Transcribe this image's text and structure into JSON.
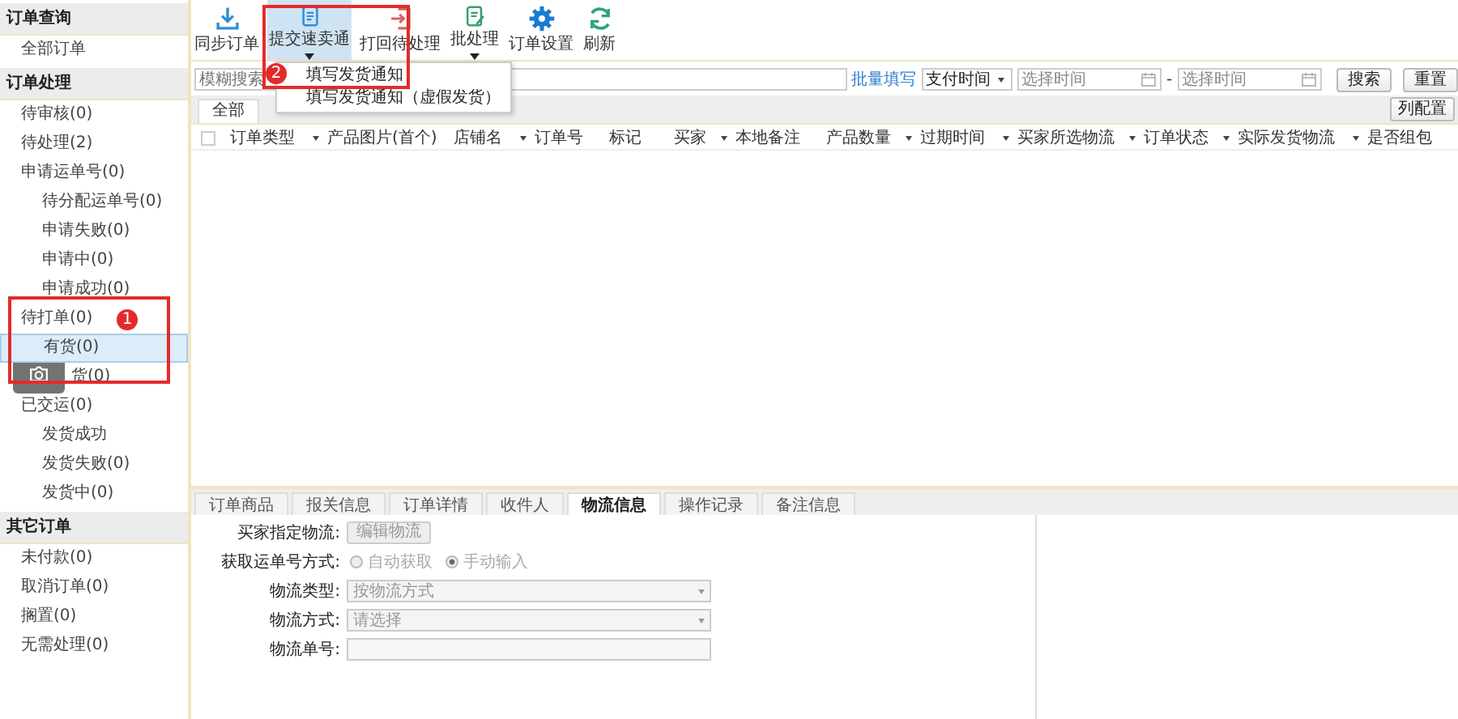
{
  "sidebar": {
    "groups": [
      {
        "title": "订单查询",
        "items": [
          {
            "label": "全部订单",
            "selected": false
          }
        ]
      },
      {
        "title": "订单处理",
        "items": [
          {
            "label": "待审核(0)",
            "selected": false
          },
          {
            "label": "待处理(2)",
            "selected": false
          },
          {
            "label": "申请运单号(0)",
            "selected": false,
            "children": [
              {
                "label": "待分配运单号(0)",
                "selected": false
              },
              {
                "label": "申请失败(0)",
                "selected": false
              },
              {
                "label": "申请中(0)",
                "selected": false
              },
              {
                "label": "申请成功(0)",
                "selected": false
              }
            ]
          },
          {
            "label": "待打单(0)",
            "selected": false,
            "children": [
              {
                "label": "有货(0)",
                "selected": true
              },
              {
                "label": "货(0)",
                "selected": false,
                "covered": true
              }
            ]
          },
          {
            "label": "已交运(0)",
            "selected": false,
            "children": [
              {
                "label": "发货成功",
                "selected": false
              },
              {
                "label": "发货失败(0)",
                "selected": false
              },
              {
                "label": "发货中(0)",
                "selected": false
              }
            ]
          }
        ]
      },
      {
        "title": "其它订单",
        "items": [
          {
            "label": "未付款(0)",
            "selected": false
          },
          {
            "label": "取消订单(0)",
            "selected": false
          },
          {
            "label": "搁置(0)",
            "selected": false
          },
          {
            "label": "无需处理(0)",
            "selected": false
          }
        ]
      }
    ]
  },
  "toolbar": [
    {
      "label": "同步订单",
      "kind": "download",
      "active": false,
      "dropdown": false
    },
    {
      "label": "提交速卖通",
      "kind": "document",
      "active": true,
      "dropdown": true
    },
    {
      "label": "打回待处理",
      "kind": "return",
      "active": false,
      "dropdown": false
    },
    {
      "label": "批处理",
      "kind": "edit",
      "active": false,
      "dropdown": true
    },
    {
      "label": "订单设置",
      "kind": "gear",
      "active": false,
      "dropdown": false
    },
    {
      "label": "刷新",
      "kind": "refresh",
      "active": false,
      "dropdown": false
    }
  ],
  "dropdown_menu": [
    "填写发货通知",
    "填写发货通知（虚假发货）"
  ],
  "search": {
    "placeholder": "模糊搜索",
    "batch_link": "批量填写",
    "time_type": "支付时间",
    "from_placeholder": "选择时间",
    "separator": "-",
    "to_placeholder": "选择时间",
    "search_button": "搜索",
    "reset_button": "重置"
  },
  "tabs": [
    {
      "label": "全部",
      "selected": true
    }
  ],
  "column_config_button": "列配置",
  "table": {
    "header_checkbox": {
      "checked": false
    },
    "columns": [
      {
        "label": "订单类型",
        "sortable": true
      },
      {
        "label": "产品图片(首个)",
        "sortable": false
      },
      {
        "label": "店铺名",
        "sortable": true
      },
      {
        "label": "订单号",
        "sortable": false
      },
      {
        "label": "标记",
        "sortable": false
      },
      {
        "label": "买家",
        "sortable": true
      },
      {
        "label": "本地备注",
        "sortable": false
      },
      {
        "label": "产品数量",
        "sortable": true
      },
      {
        "label": "过期时间",
        "sortable": true
      },
      {
        "label": "买家所选物流",
        "sortable": true
      },
      {
        "label": "订单状态",
        "sortable": true
      },
      {
        "label": "实际发货物流",
        "sortable": true
      },
      {
        "label": "是否组包",
        "sortable": false
      }
    ]
  },
  "detail_tabs": [
    {
      "label": "订单商品",
      "selected": false
    },
    {
      "label": "报关信息",
      "selected": false
    },
    {
      "label": "订单详情",
      "selected": false
    },
    {
      "label": "收件人",
      "selected": false
    },
    {
      "label": "物流信息",
      "selected": true
    },
    {
      "label": "操作记录",
      "selected": false
    },
    {
      "label": "备注信息",
      "selected": false
    }
  ],
  "logistics_form": {
    "buyer_logistics": {
      "label": "买家指定物流:",
      "button": "编辑物流",
      "disabled": true
    },
    "tracking_method": {
      "label": "获取运单号方式:",
      "disabled": true,
      "options": [
        {
          "label": "自动获取",
          "selected": false
        },
        {
          "label": "手动输入",
          "selected": true
        }
      ]
    },
    "logistics_type": {
      "label": "物流类型:",
      "placeholder": "按物流方式"
    },
    "logistics_method": {
      "label": "物流方式:",
      "placeholder": "请选择"
    },
    "tracking_number": {
      "label": "物流单号:"
    }
  },
  "annotations": [
    {
      "number": "1"
    },
    {
      "number": "2"
    }
  ]
}
